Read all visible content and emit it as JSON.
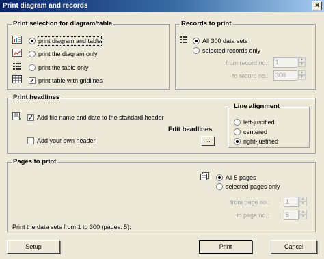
{
  "window": {
    "title": "Print diagram and records",
    "close": "×"
  },
  "selection": {
    "title": "Print selection for diagram/table",
    "options": [
      "print diagram and table",
      "print the diagram only",
      "print the table only"
    ],
    "gridlines": "print table with gridlines"
  },
  "records": {
    "title": "Records to print",
    "all": "All 300 data sets",
    "selected": "selected records only",
    "from_label": "from record no.:",
    "from_value": "1",
    "to_label": "to record no.:",
    "to_value": "300"
  },
  "headlines": {
    "title": "Print headlines",
    "standard": "Add file name and date to the standard header",
    "own": "Add your own header",
    "edit_label": "Edit headlines",
    "edit_button": "...",
    "alignment": {
      "title": "Line alignment",
      "options": [
        "left-justified",
        "centered",
        "right-justified"
      ]
    }
  },
  "pages": {
    "title": "Pages to print",
    "all": "All 5 pages",
    "selected": "selected pages only",
    "from_label": "from page no.:",
    "from_value": "1",
    "to_label": "to page no.:",
    "to_value": "5",
    "summary": "Print the data sets from 1 to 300 (pages: 5)."
  },
  "buttons": {
    "setup": "Setup",
    "print": "Print",
    "cancel": "Cancel"
  },
  "state": {
    "selection_option": 0,
    "gridlines_checked": true,
    "records_all": true,
    "standard_checked": true,
    "own_checked": false,
    "alignment_option": 2,
    "pages_all": true
  }
}
